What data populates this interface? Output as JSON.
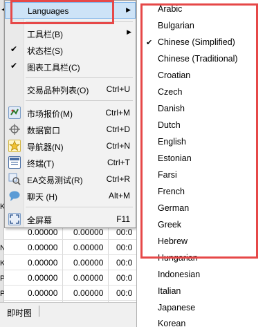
{
  "background": {
    "left_chars": [
      "◄",
      "K",
      "N",
      "K",
      "P",
      "P"
    ],
    "table_rows": [
      [
        "0.00000",
        "0.00000",
        "00:0"
      ],
      [
        "0.00000",
        "0.00000",
        "00:0"
      ],
      [
        "0.00000",
        "0.00000",
        "00:0"
      ],
      [
        "0.00000",
        "0.00000",
        "00:0"
      ],
      [
        "0.00000",
        "0.00000",
        "00:0"
      ]
    ],
    "bottom_tab": "即时图"
  },
  "menu": {
    "languages_label": "Languages",
    "toolbar_label": "工具栏(B)",
    "statusbar_label": "状态栏(S)",
    "chart_toolbar_label": "图表工具栏(C)",
    "symbols_label": "交易品种列表(O)",
    "symbols_shortcut": "Ctrl+U",
    "market_watch_label": "市场报价(M)",
    "market_watch_shortcut": "Ctrl+M",
    "data_window_label": "数据窗口",
    "data_window_shortcut": "Ctrl+D",
    "navigator_label": "导航器(N)",
    "navigator_shortcut": "Ctrl+N",
    "terminal_label": "终端(T)",
    "terminal_shortcut": "Ctrl+T",
    "tester_label": "EA交易测试(R)",
    "tester_shortcut": "Ctrl+R",
    "chat_label": "聊天 (H)",
    "chat_shortcut": "Alt+M",
    "fullscreen_label": "全屏幕",
    "fullscreen_shortcut": "F11",
    "check_glyph": "✔",
    "arrow_glyph": "▶"
  },
  "languages": {
    "items": [
      "Arabic",
      "Bulgarian",
      "Chinese (Simplified)",
      "Chinese (Traditional)",
      "Croatian",
      "Czech",
      "Danish",
      "Dutch",
      "English",
      "Estonian",
      "Farsi",
      "French",
      "German",
      "Greek",
      "Hebrew",
      "Hungarian",
      "Indonesian",
      "Italian",
      "Japanese",
      "Korean"
    ],
    "selected": "Chinese (Simplified)",
    "check_glyph": "✔"
  },
  "colors": {
    "annotation": "#e64848",
    "highlight": "#cde3f7"
  }
}
